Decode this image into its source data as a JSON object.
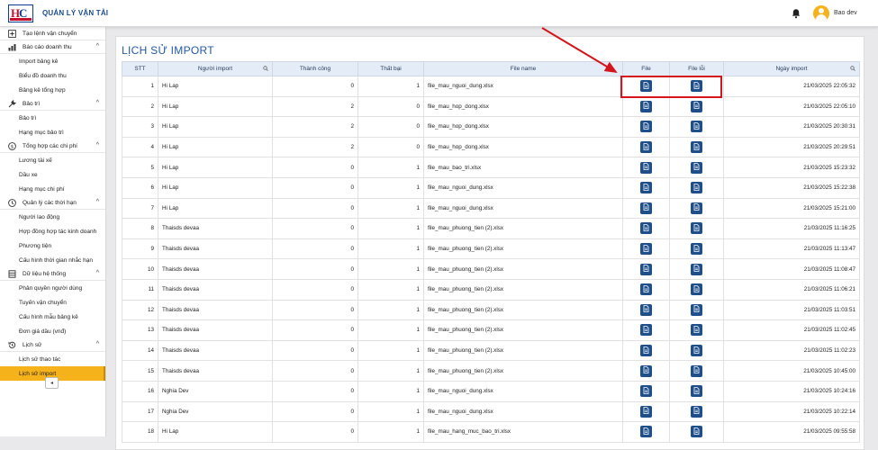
{
  "app": {
    "title": "QUẢN LÝ VẬN TẢI",
    "logo": "HC",
    "user": "Bao dev"
  },
  "sidebar": {
    "top_item": "Tạo lệnh vận chuyển",
    "sections": [
      {
        "label": "Báo cáo doanh thu",
        "icon": "chart-icon",
        "items": [
          "Import bảng kê",
          "Biểu đồ doanh thu",
          "Bảng kê tổng hợp"
        ]
      },
      {
        "label": "Bảo trì",
        "icon": "wrench-icon",
        "items": [
          "Bảo trì",
          "Hạng mục bảo trì"
        ]
      },
      {
        "label": "Tổng hợp các chi phí",
        "icon": "dollar-icon",
        "items": [
          "Lương tài xế",
          "Dầu xe",
          "Hạng mục chi phí"
        ]
      },
      {
        "label": "Quản lý các thời hạn",
        "icon": "clock-icon",
        "items": [
          "Người lao động",
          "Hợp đồng hợp tác kinh doanh",
          "Phương tiện",
          "Cấu hình thời gian nhắc hạn"
        ]
      },
      {
        "label": "Dữ liệu hệ thống",
        "icon": "database-icon",
        "items": [
          "Phân quyền người dùng",
          "Tuyến vận chuyển",
          "Cấu hình mẫu bảng kê",
          "Đơn giá dầu (vnđ)"
        ]
      },
      {
        "label": "Lịch sử",
        "icon": "history-icon",
        "items": [
          "Lịch sử thao tác",
          "Lịch sử import"
        ]
      }
    ],
    "active_item": "Lịch sử import",
    "collapse": "◂"
  },
  "page": {
    "title": "LỊCH SỬ IMPORT"
  },
  "table": {
    "headers": [
      "STT",
      "Người import",
      "Thành công",
      "Thất bại",
      "File name",
      "File",
      "File lỗi",
      "Ngày import"
    ],
    "rows": [
      [
        "1",
        "Hi Lap",
        "0",
        "1",
        "file_mau_nguoi_dung.xlsx",
        "21/03/2025 22:05:32"
      ],
      [
        "2",
        "Hi Lap",
        "2",
        "0",
        "file_mau_hop_dong.xlsx",
        "21/03/2025 22:05:10"
      ],
      [
        "3",
        "Hi Lap",
        "2",
        "0",
        "file_mau_hop_dong.xlsx",
        "21/03/2025 20:30:31"
      ],
      [
        "4",
        "Hi Lap",
        "2",
        "0",
        "file_mau_hop_dong.xlsx",
        "21/03/2025 20:29:51"
      ],
      [
        "5",
        "Hi Lap",
        "0",
        "1",
        "file_mau_bao_tri.xlsx",
        "21/03/2025 15:23:32"
      ],
      [
        "6",
        "Hi Lap",
        "0",
        "1",
        "file_mau_nguoi_dung.xlsx",
        "21/03/2025 15:22:38"
      ],
      [
        "7",
        "Hi Lap",
        "0",
        "1",
        "file_mau_nguoi_dung.xlsx",
        "21/03/2025 15:21:00"
      ],
      [
        "8",
        "Thaisds devaa",
        "0",
        "1",
        "file_mau_phuong_tien (2).xlsx",
        "21/03/2025 11:16:25"
      ],
      [
        "9",
        "Thaisds devaa",
        "0",
        "1",
        "file_mau_phuong_tien (2).xlsx",
        "21/03/2025 11:13:47"
      ],
      [
        "10",
        "Thaisds devaa",
        "0",
        "1",
        "file_mau_phuong_tien (2).xlsx",
        "21/03/2025 11:08:47"
      ],
      [
        "11",
        "Thaisds devaa",
        "0",
        "1",
        "file_mau_phuong_tien (2).xlsx",
        "21/03/2025 11:06:21"
      ],
      [
        "12",
        "Thaisds devaa",
        "0",
        "1",
        "file_mau_phuong_tien (2).xlsx",
        "21/03/2025 11:03:51"
      ],
      [
        "13",
        "Thaisds devaa",
        "0",
        "1",
        "file_mau_phuong_tien (2).xlsx",
        "21/03/2025 11:02:45"
      ],
      [
        "14",
        "Thaisds devaa",
        "0",
        "1",
        "file_mau_phuong_tien (2).xlsx",
        "21/03/2025 11:02:23"
      ],
      [
        "15",
        "Thaisds devaa",
        "0",
        "1",
        "file_mau_phuong_tien (2).xlsx",
        "21/03/2025 10:45:00"
      ],
      [
        "16",
        "Nghia Dev",
        "0",
        "1",
        "file_mau_nguoi_dung.xlsx",
        "21/03/2025 10:24:16"
      ],
      [
        "17",
        "Nghia Dev",
        "0",
        "1",
        "file_mau_nguoi_dung.xlsx",
        "21/03/2025 10:22:14"
      ],
      [
        "18",
        "Hi Lap",
        "0",
        "1",
        "file_mau_hang_muc_bao_tri.xlsx",
        "21/03/2025 09:55:58"
      ]
    ]
  },
  "colors": {
    "accent": "#f6b21a",
    "primary": "#1f4f8a",
    "header_bg": "#e3ecf7",
    "highlight": "#d4161c"
  }
}
